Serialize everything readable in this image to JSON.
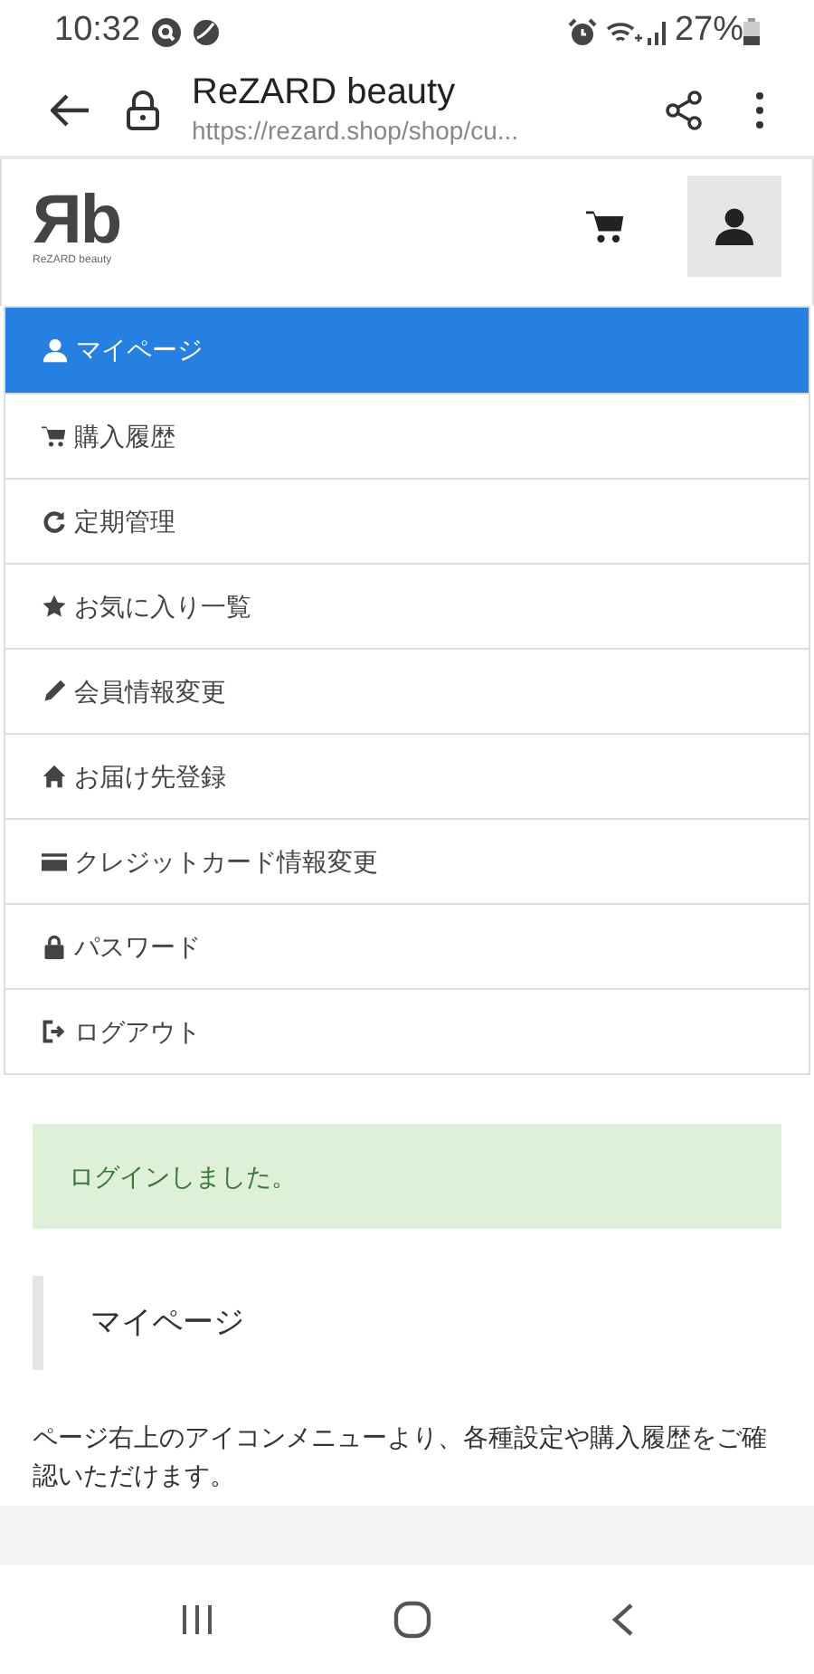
{
  "status_bar": {
    "time": "10:32",
    "battery": "27%"
  },
  "browser": {
    "title": "ReZARD beauty",
    "url": "https://rezard.shop/shop/cu..."
  },
  "site_header": {
    "logo": "Яb",
    "logo_sub": "ReZARD beauty"
  },
  "menu": [
    {
      "kind": "user",
      "label": "マイページ",
      "selected": true
    },
    {
      "kind": "cart",
      "label": "購入履歴",
      "selected": false
    },
    {
      "kind": "refresh",
      "label": "定期管理",
      "selected": false
    },
    {
      "kind": "star",
      "label": "お気に入り一覧",
      "selected": false
    },
    {
      "kind": "pencil",
      "label": "会員情報変更",
      "selected": false
    },
    {
      "kind": "home",
      "label": "お届け先登録",
      "selected": false
    },
    {
      "kind": "card",
      "label": "クレジットカード情報変更",
      "selected": false
    },
    {
      "kind": "lock",
      "label": "パスワード",
      "selected": false
    },
    {
      "kind": "logout",
      "label": "ログアウト",
      "selected": false
    }
  ],
  "alert": "ログインしました。",
  "heading": "マイページ",
  "description": "ページ右上のアイコンメニューより、各種設定や購入履歴をご確認いただけます。"
}
